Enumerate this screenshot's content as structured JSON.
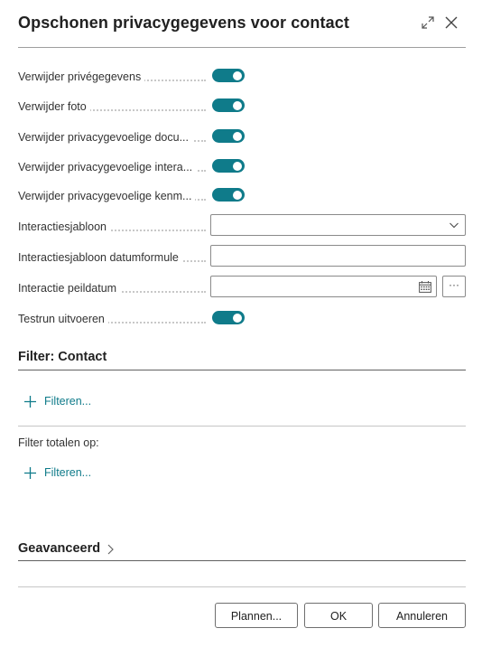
{
  "dialog": {
    "title": "Opschonen privacygegevens voor contact"
  },
  "fields": {
    "remove_private": {
      "label": "Verwijder privégegevens",
      "value": true
    },
    "remove_photo": {
      "label": "Verwijder foto",
      "value": true
    },
    "remove_privacy_docs": {
      "label": "Verwijder privacygevoelige docu...",
      "value": true
    },
    "remove_privacy_interactions": {
      "label": "Verwijder privacygevoelige intera...",
      "value": true
    },
    "remove_privacy_profile": {
      "label": "Verwijder privacygevoelige kenm...",
      "value": true
    },
    "interaction_template": {
      "label": "Interactiesjabloon",
      "value": ""
    },
    "interaction_template_date_formula": {
      "label": "Interactiesjabloon datumformule",
      "value": ""
    },
    "interaction_reference_date": {
      "label": "Interactie peildatum",
      "value": ""
    },
    "test_run": {
      "label": "Testrun uitvoeren",
      "value": true
    }
  },
  "filter_contact": {
    "title": "Filter: Contact",
    "add_filter_label": "Filteren..."
  },
  "filter_totals": {
    "label": "Filter totalen op:",
    "add_filter_label": "Filteren..."
  },
  "advanced": {
    "label": "Geavanceerd"
  },
  "buttons": {
    "schedule": "Plannen...",
    "ok": "OK",
    "cancel": "Annuleren"
  },
  "lookup_button_label": "···",
  "colors": {
    "accent": "#0f7b8a",
    "toggle_knob": "#ffffff"
  }
}
